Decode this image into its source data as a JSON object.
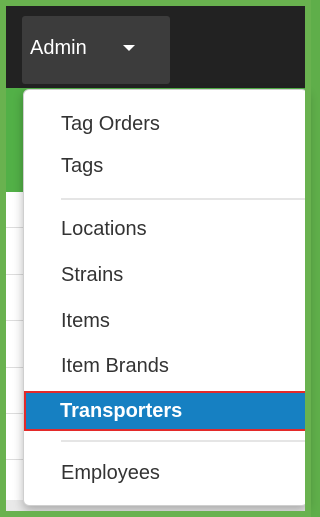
{
  "navbar": {
    "admin_label": "Admin"
  },
  "admin_menu": {
    "items": [
      {
        "label": "Tag Orders"
      },
      {
        "label": "Tags"
      },
      {
        "label": "Locations"
      },
      {
        "label": "Strains"
      },
      {
        "label": "Items"
      },
      {
        "label": "Item Brands"
      },
      {
        "label": "Transporters",
        "highlighted": true
      },
      {
        "label": "Employees"
      }
    ]
  },
  "colors": {
    "navbar_bg": "#222222",
    "active_item_bg": "#1680c2",
    "highlight_outline": "#e32a2a",
    "page_accent_green": "#52b047"
  },
  "icons": {
    "admin_caret": "caret-down-icon"
  }
}
